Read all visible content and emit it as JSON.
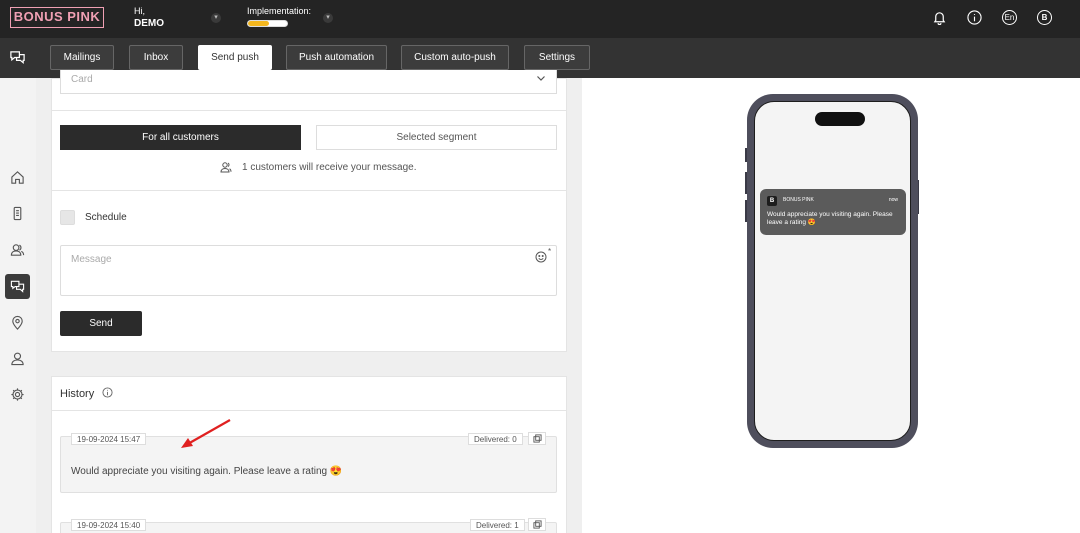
{
  "header": {
    "logo": "BONUS PINK",
    "greeting": "Hi,",
    "user": "DEMO",
    "implementation_label": "Implementation:",
    "implementation_progress": 0.55,
    "lang": "En",
    "avatar": "B"
  },
  "nav": {
    "tabs": [
      {
        "label": "Mailings"
      },
      {
        "label": "Inbox"
      },
      {
        "label": "Send push"
      },
      {
        "label": "Push automation"
      },
      {
        "label": "Custom auto-push"
      },
      {
        "label": "Settings"
      }
    ],
    "active": "Send push"
  },
  "form": {
    "select_placeholder": "Card",
    "audience_all": "For all customers",
    "audience_segment": "Selected segment",
    "recipients_text": "1 customers will receive your message.",
    "schedule_label": "Schedule",
    "message_placeholder": "Message",
    "required_mark": "*",
    "send_label": "Send"
  },
  "history": {
    "title": "History",
    "items": [
      {
        "date": "19-09-2024 15:47",
        "delivered": "Delivered: 0",
        "text": "Would appreciate you visiting again. Please leave a rating 😍"
      },
      {
        "date": "19-09-2024 15:40",
        "delivered": "Delivered: 1"
      }
    ]
  },
  "preview": {
    "app_name": "BONUS PINK",
    "app_icon": "B",
    "time": "now",
    "message": "Would appreciate you visiting again. Please leave a rating 😍"
  },
  "colors": {
    "brand_pink": "#f0a0b4",
    "topbar": "#242424",
    "navbar": "#333333",
    "progress": "#f3b61e",
    "annotation_arrow": "#e02020"
  }
}
